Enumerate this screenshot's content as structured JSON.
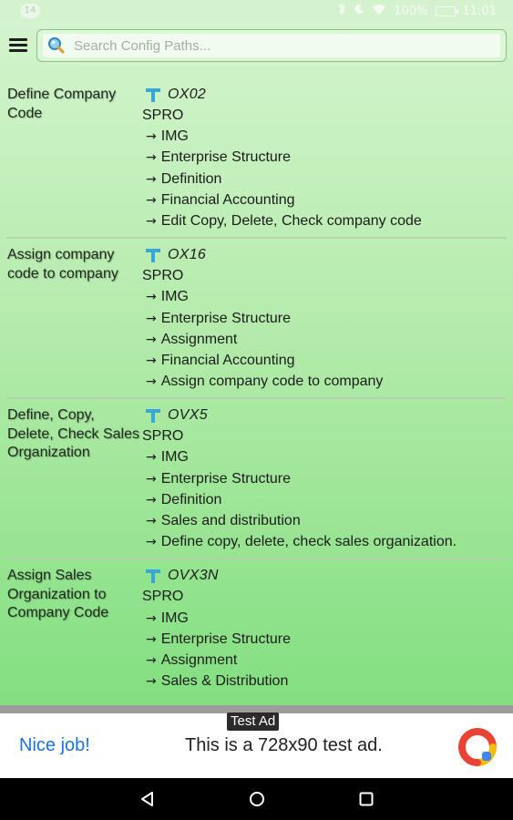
{
  "status_bar": {
    "notification_badge": "14",
    "battery": "100%",
    "time": "11:01",
    "icons": [
      "bluetooth-icon",
      "moon-icon",
      "wifi-icon",
      "battery-icon"
    ]
  },
  "search": {
    "placeholder": "Search Config Paths..."
  },
  "entries": [
    {
      "name": "Define Company Code",
      "tcode": "OX02",
      "root": "SPRO",
      "path": [
        "IMG",
        "Enterprise Structure",
        "Definition",
        "Financial Accounting",
        "Edit Copy, Delete, Check company code"
      ]
    },
    {
      "name": "Assign company code to company",
      "tcode": "OX16",
      "root": "SPRO",
      "path": [
        "IMG",
        "Enterprise Structure",
        "Assignment",
        "Financial Accounting",
        "Assign company code to company"
      ]
    },
    {
      "name": "Define, Copy, Delete, Check Sales Organization",
      "tcode": "OVX5",
      "root": "SPRO",
      "path": [
        "IMG",
        "Enterprise Structure",
        "Definition",
        "Sales and distribution",
        "Define copy, delete, check sales organization."
      ]
    },
    {
      "name": "Assign Sales Organization to Company Code",
      "tcode": "OVX3N",
      "root": "SPRO",
      "path": [
        "IMG",
        "Enterprise Structure",
        "Assignment",
        "Sales & Distribution"
      ]
    }
  ],
  "arrow_glyph": "→",
  "ad": {
    "label": "Test Ad",
    "headline": "Nice job!",
    "body": "This is a 728x90 test ad."
  },
  "colors": {
    "app_gradient_top": "#d3f4cd",
    "app_gradient_bottom": "#83df80",
    "tcode_icon": "#35a7d9",
    "ad_headline": "#1a73e8"
  }
}
